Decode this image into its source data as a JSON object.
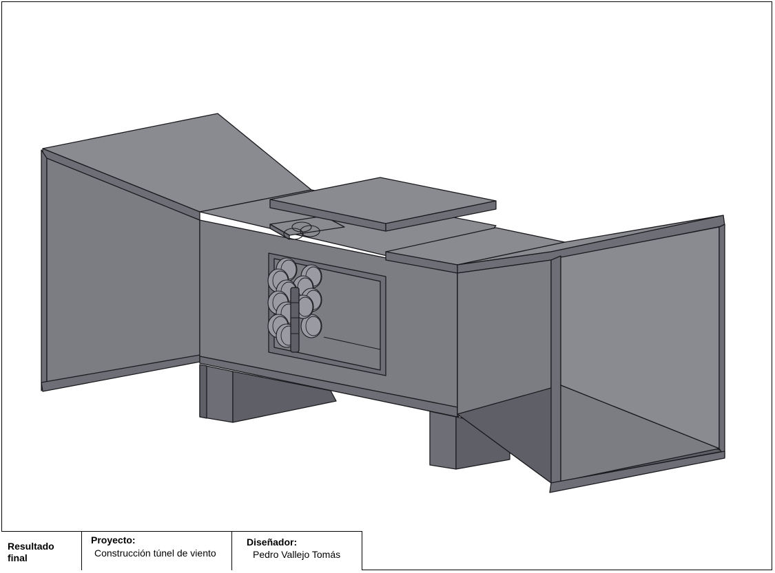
{
  "title_block": {
    "result_label": "Resultado final",
    "project_label": "Proyecto:",
    "project_value": "Construcción túnel de viento",
    "designer_label": "Diseñador:",
    "designer_value": "Pedro Vallejo Tomás"
  },
  "colors": {
    "face_light": "#8a8a91",
    "face_mid": "#7c7c83",
    "face_dark": "#6e6e76",
    "face_darker": "#5f5f68",
    "edge": "#1a1a1e",
    "honeycomb": "#9a9aa2"
  }
}
